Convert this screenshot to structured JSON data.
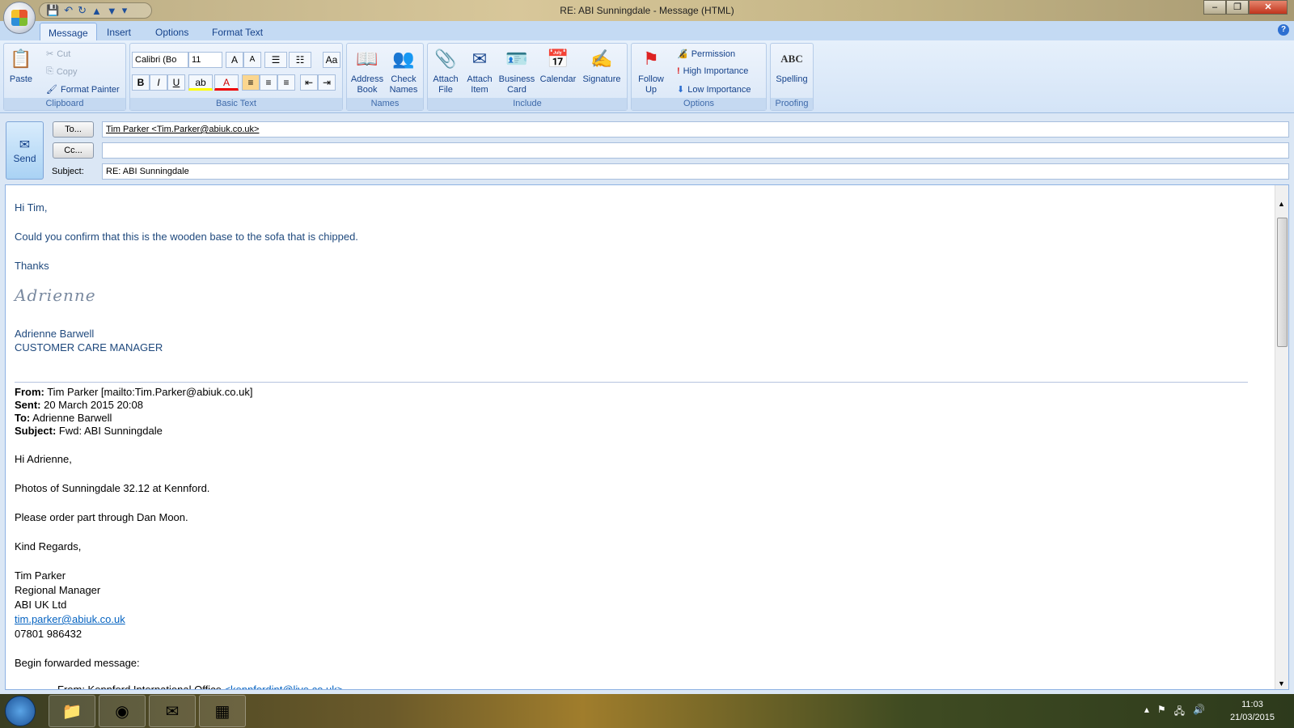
{
  "window": {
    "title": "RE: ABI Sunningdale - Message (HTML)",
    "minimize": "–",
    "restore": "❐",
    "close": "✕"
  },
  "tabs": [
    "Message",
    "Insert",
    "Options",
    "Format Text"
  ],
  "ribbon": {
    "clipboard": {
      "label": "Clipboard",
      "paste": "Paste",
      "cut": "Cut",
      "copy": "Copy",
      "format_painter": "Format Painter"
    },
    "basic_text": {
      "label": "Basic Text",
      "font": "Calibri (Bo",
      "size": "11",
      "bold": "B",
      "italic": "I",
      "underline": "U"
    },
    "names": {
      "label": "Names",
      "address_book": "Address Book",
      "check_names": "Check Names"
    },
    "include": {
      "label": "Include",
      "attach_file": "Attach File",
      "attach_item": "Attach Item",
      "business_card": "Business Card",
      "calendar": "Calendar",
      "signature": "Signature"
    },
    "options": {
      "label": "Options",
      "follow_up": "Follow Up",
      "permission": "Permission",
      "high": "High Importance",
      "low": "Low Importance"
    },
    "proofing": {
      "label": "Proofing",
      "spelling": "Spelling",
      "abc": "ABC"
    }
  },
  "header": {
    "send": "Send",
    "to_button": "To...",
    "cc_button": "Cc...",
    "subject_label": "Subject:",
    "to_value": "Tim Parker  <Tim.Parker@abiuk.co.uk>",
    "cc_value": "",
    "subject_value": "RE: ABI Sunningdale"
  },
  "body": {
    "greeting": "Hi Tim,",
    "line1": "Could you confirm that this is the wooden base to the sofa that is chipped.",
    "thanks": "Thanks",
    "signature_script": "Adrienne",
    "sig_name": "Adrienne Barwell",
    "sig_title": "CUSTOMER CARE MANAGER",
    "from_label": "From:",
    "from_value": " Tim Parker [mailto:Tim.Parker@abiuk.co.uk]",
    "sent_label": "Sent:",
    "sent_value": " 20 March 2015 20:08",
    "to_label": "To:",
    "to_value": " Adrienne Barwell",
    "subject_label": "Subject:",
    "subject_value": " Fwd: ABI Sunningdale",
    "q_greeting": "Hi Adrienne,",
    "q_line1": "Photos of Sunningdale 32.12 at Kennford.",
    "q_line2": "Please order part through Dan Moon.",
    "q_regards": "Kind Regards,",
    "q_name": "Tim Parker",
    "q_title": "Regional Manager",
    "q_company": "ABI UK Ltd",
    "q_email": "tim.parker@abiuk.co.uk",
    "q_phone": "07801 986432",
    "q_forward": "Begin forwarded message:",
    "fwd_from": "From: Kennford International Office ",
    "fwd_email": "<kennfordint@live.co.uk>"
  },
  "taskbar": {
    "time": "11:03",
    "date": "21/03/2015"
  }
}
